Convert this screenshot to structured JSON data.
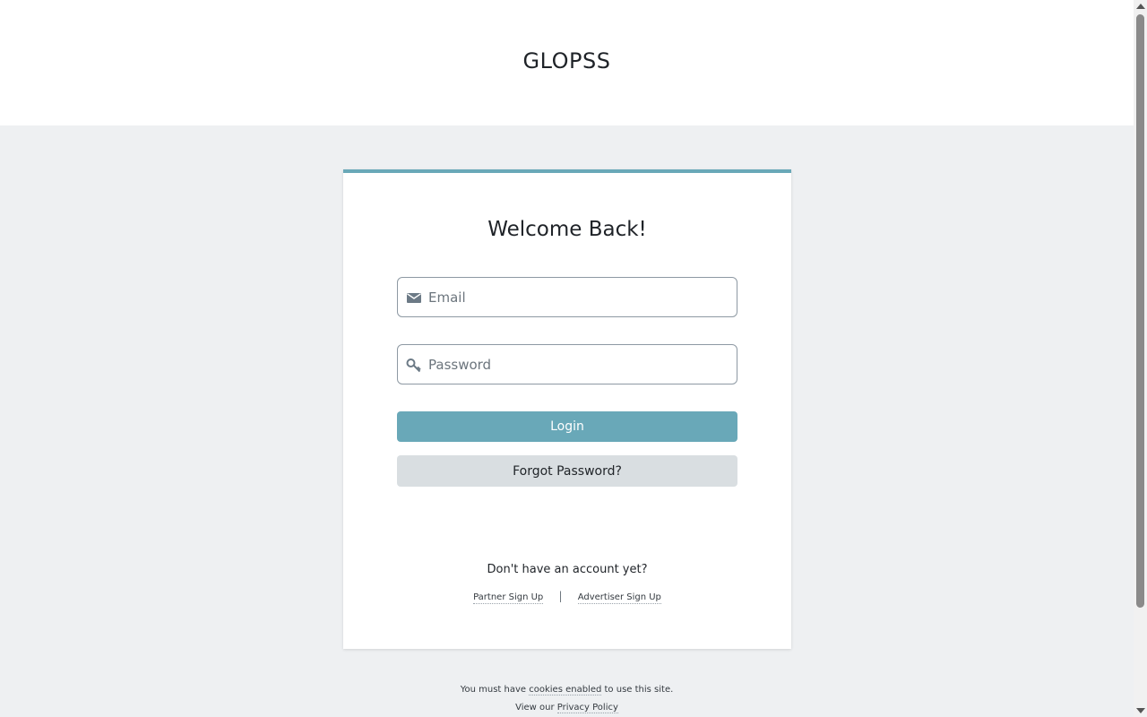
{
  "header": {
    "brand": "GLOPSS"
  },
  "login": {
    "title": "Welcome Back!",
    "email": {
      "placeholder": "Email",
      "value": "",
      "icon": "envelope-icon"
    },
    "password": {
      "placeholder": "Password",
      "value": "",
      "icon": "key-icon"
    },
    "login_button": "Login",
    "forgot_button": "Forgot Password?",
    "no_account_text": "Don't have an account yet?",
    "partner_signup": "Partner Sign Up",
    "separator": "|",
    "advertiser_signup": "Advertiser Sign Up"
  },
  "footer": {
    "cookies_prefix": "You must have",
    "cookies_link": "cookies enabled",
    "cookies_suffix": "to use this site.",
    "privacy_prefix": "View our",
    "privacy_link": "Privacy Policy"
  },
  "colors": {
    "accent": "#69a8b8",
    "page_background": "#eef0f2",
    "secondary_button": "#d9dee1"
  }
}
